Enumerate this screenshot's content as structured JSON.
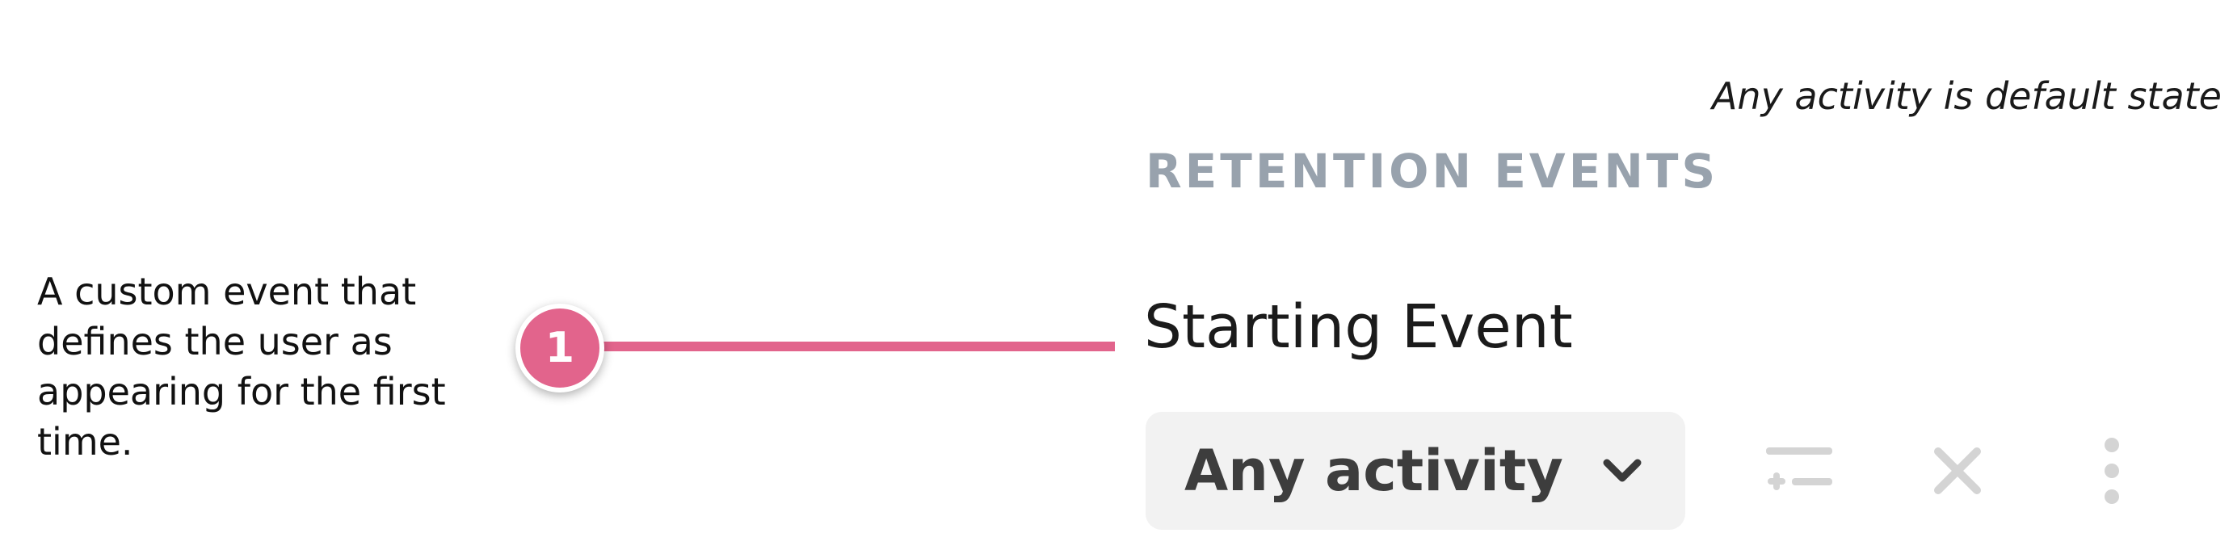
{
  "note": "Any activity is default state",
  "section_heading": "RETENTION EVENTS",
  "annotation": {
    "text": "A custom event that defines the user as appearing for the first time.",
    "badge_number": "1",
    "accent_color": "#e2648c"
  },
  "starting_event": {
    "label": "Starting Event",
    "selected_value": "Any activity",
    "icons": [
      "chevron-down-icon",
      "add-filter-icon",
      "close-icon",
      "more-vertical-icon"
    ]
  },
  "colors": {
    "heading": "#98a2ad",
    "select_background": "#f2f2f2",
    "disabled_icon": "#d4d4d4"
  }
}
